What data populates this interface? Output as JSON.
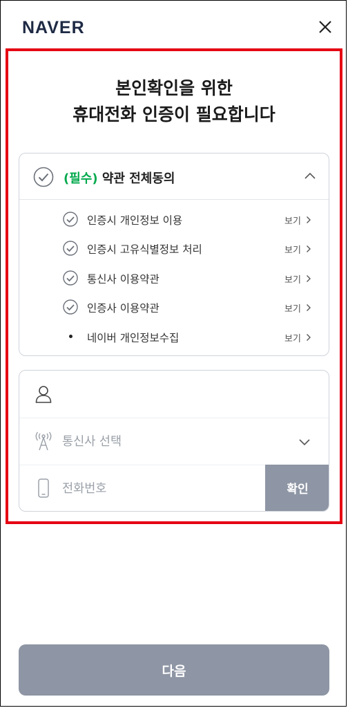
{
  "header": {
    "logo": "NAVER"
  },
  "title": {
    "line1": "본인확인을 위한",
    "line2": "휴대전화 인증이 필요합니다"
  },
  "terms": {
    "required_tag": "(필수)",
    "all_agree_label": " 약관 전체동의",
    "view_label": "보기",
    "items": [
      {
        "label": "인증시 개인정보 이용",
        "checked": true
      },
      {
        "label": "인증시 고유식별정보 처리",
        "checked": true
      },
      {
        "label": "통신사 이용약관",
        "checked": true
      },
      {
        "label": "인증사 이용약관",
        "checked": true
      },
      {
        "label": "네이버 개인정보수집",
        "checked": false
      }
    ]
  },
  "form": {
    "name_value": "",
    "carrier_placeholder": "통신사 선택",
    "phone_placeholder": "전화번호",
    "confirm_label": "확인"
  },
  "next_label": "다음",
  "colors": {
    "highlight": "#e50012",
    "required": "#03a94d",
    "button": "#8e95a4",
    "logo": "#1e2a44"
  }
}
